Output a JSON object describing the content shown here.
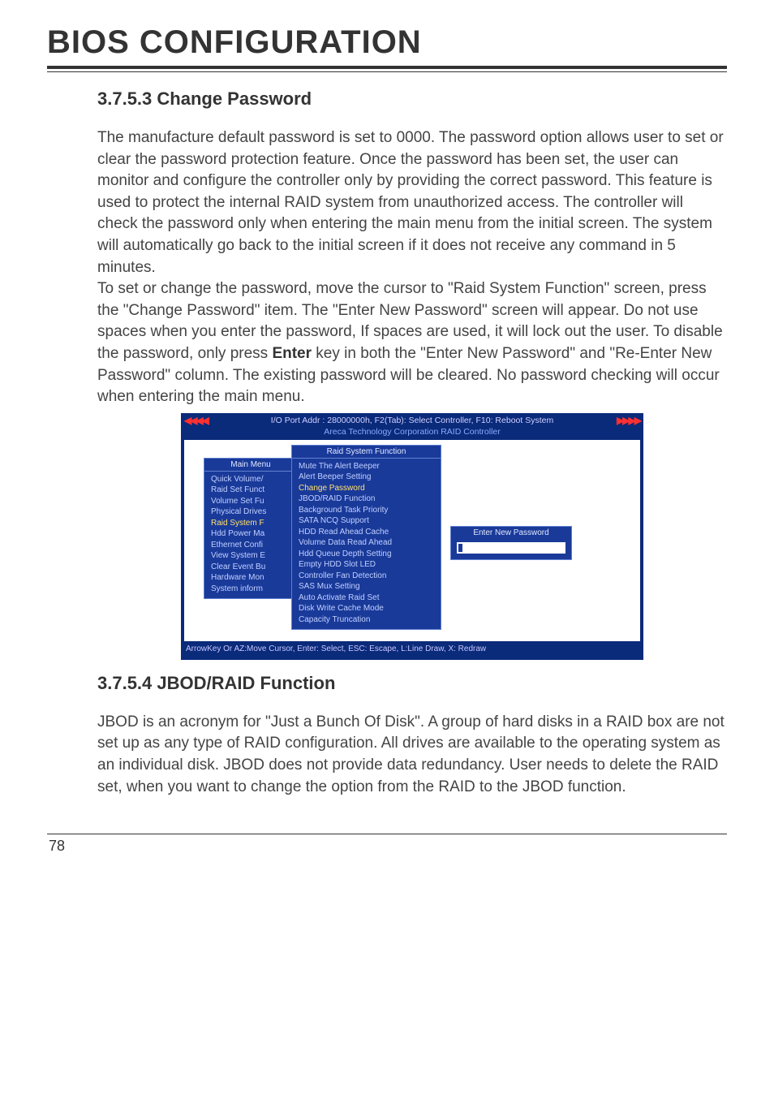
{
  "page": {
    "title": "BIOS CONFIGURATION",
    "number": "78"
  },
  "section1": {
    "heading": "3.7.5.3 Change Password",
    "p1": "The manufacture default password is set to 0000. The password option allows user to set or clear the password protection feature. Once the password has been set, the user can monitor and configure the controller only by providing the correct password. This feature is used to protect the internal RAID system from unauthorized access. The controller will check the password only when entering the main menu from the initial screen. The system will automatically go back to the initial screen if it does not receive any command in 5 minutes.",
    "p2a": "To set or change the password, move the cursor to \"Raid System Function\" screen, press the \"Change Password\" item. The \"Enter New Password\" screen will appear. Do not use spaces when you enter the password, If spaces are used, it will lock out the user. To disable the password, only press ",
    "p2bold": "Enter",
    "p2b": " key in both the \"Enter New Password\" and \"Re-Enter New Password\" column. The existing password will be cleared. No password checking will occur when entering the main menu."
  },
  "tui": {
    "header_line1": "I/O Port Addr : 28000000h, F2(Tab): Select Controller, F10: Reboot System",
    "header_line2": "Areca Technology Corporation RAID Controller",
    "arrows_left": "◀◀◀◀",
    "arrows_right": "▶▶▶▶",
    "main_menu": {
      "title": "Main Menu",
      "items": [
        "Quick Volume/",
        "Raid Set Funct",
        "Volume Set Fu",
        "Physical Drives",
        "Raid System F",
        "Hdd Power Ma",
        "Ethernet Confi",
        "View System E",
        "Clear Event Bu",
        "Hardware Mon",
        "System inform"
      ],
      "highlighted_index": 4
    },
    "raid_func": {
      "title": "Raid System Function",
      "items": [
        "Mute The Alert Beeper",
        "Alert Beeper Setting",
        "Change Password",
        "JBOD/RAID Function",
        "Background Task Priority",
        "SATA NCQ Support",
        "HDD Read Ahead Cache",
        "Volume Data Read Ahead",
        "Hdd Queue Depth Setting",
        "Empty HDD Slot LED",
        "Controller Fan Detection",
        "SAS Mux Setting",
        "Auto Activate Raid Set",
        "Disk Write Cache Mode",
        "Capacity Truncation"
      ],
      "highlighted_index": 2
    },
    "new_pw": {
      "title": "Enter New Password"
    },
    "footer": "ArrowKey Or AZ:Move Cursor, Enter: Select, ESC: Escape, L:Line Draw, X: Redraw"
  },
  "section2": {
    "heading": "3.7.5.4 JBOD/RAID Function",
    "p1": "JBOD is an acronym for \"Just a Bunch Of Disk\". A group of hard disks in a RAID box are not set up as any type of RAID configuration. All drives are available to the operating system as an individual disk. JBOD does not provide data redundancy. User needs to delete the RAID set, when you want to change the option from the RAID to the JBOD function."
  }
}
